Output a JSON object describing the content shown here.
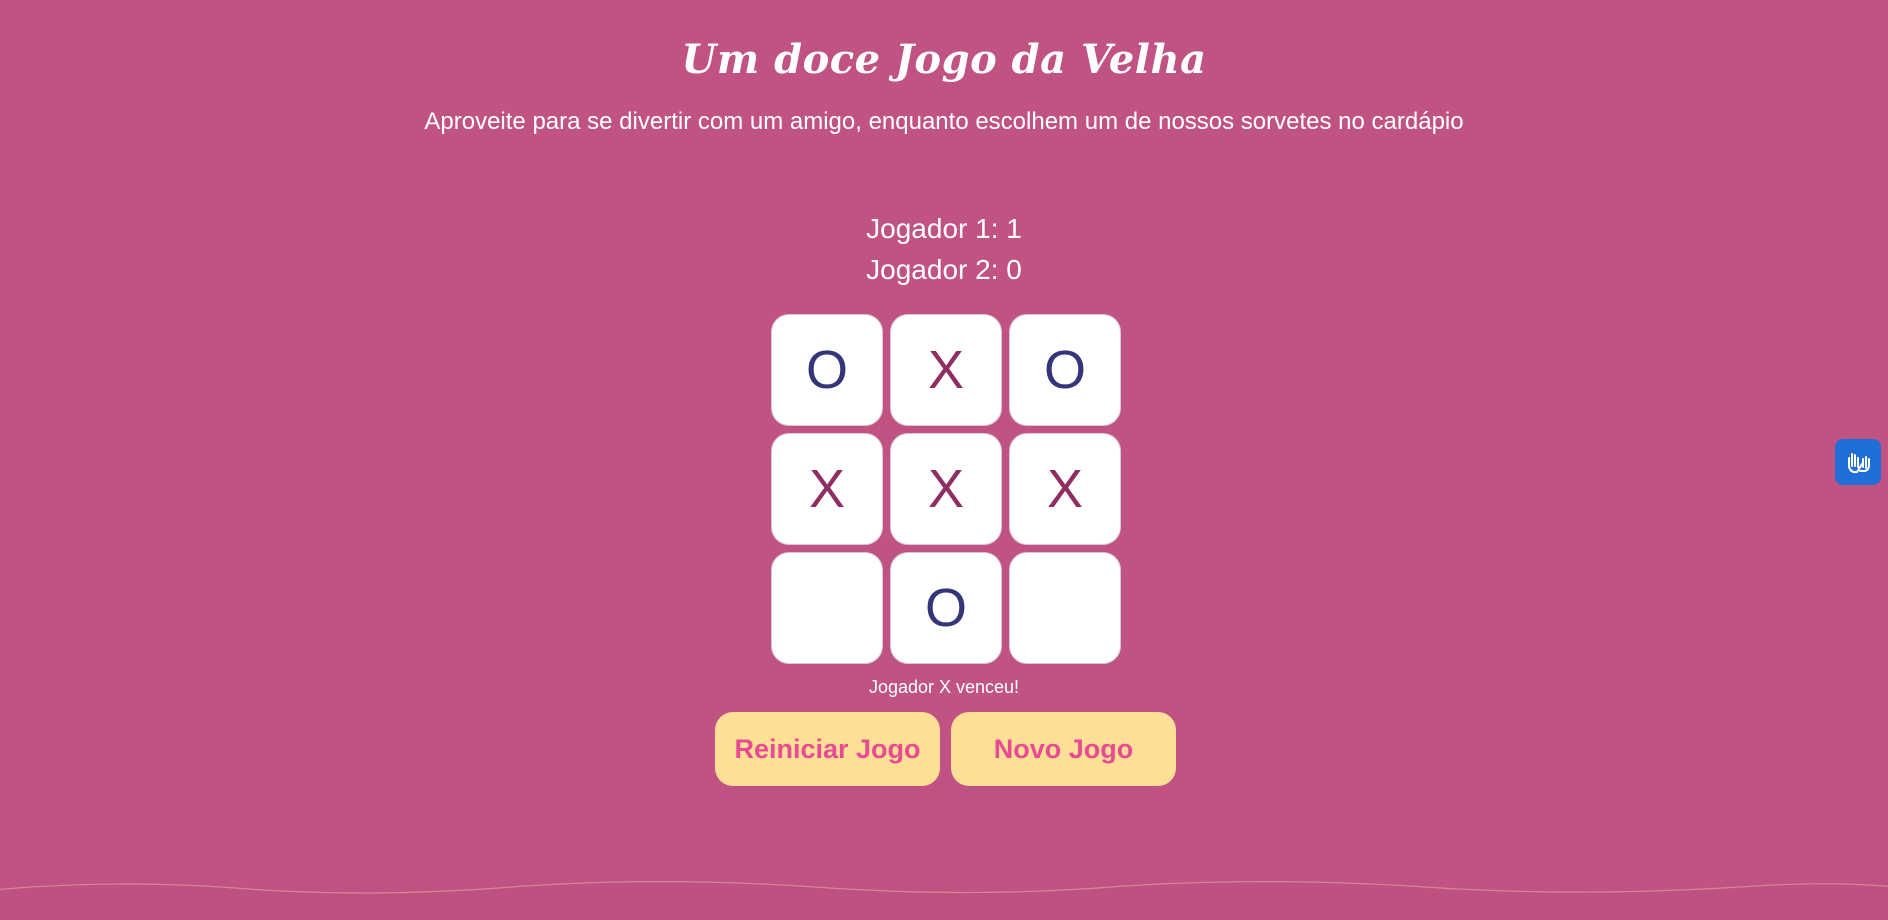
{
  "header": {
    "title": "Um doce Jogo da Velha",
    "subtitle": "Aproveite para se divertir com um amigo, enquanto escolhem um de nossos sorvetes no cardápio"
  },
  "scores": {
    "player1": "Jogador 1: 1",
    "player2": "Jogador 2: 0"
  },
  "board": {
    "cells": [
      "O",
      "X",
      "O",
      "X",
      "X",
      "X",
      "",
      "O",
      ""
    ]
  },
  "status": "Jogador X venceu!",
  "buttons": {
    "reset_label": "Reiniciar Jogo",
    "new_label": "Novo Jogo"
  },
  "accessibility": {
    "icon": "sign-language-hands-icon"
  },
  "colors": {
    "background": "#c05284",
    "mark_o": "#353679",
    "mark_x": "#8e2e62",
    "button_bg": "#fde096",
    "button_text": "#ea4a94",
    "a11y_bg": "#1f6fd6"
  }
}
